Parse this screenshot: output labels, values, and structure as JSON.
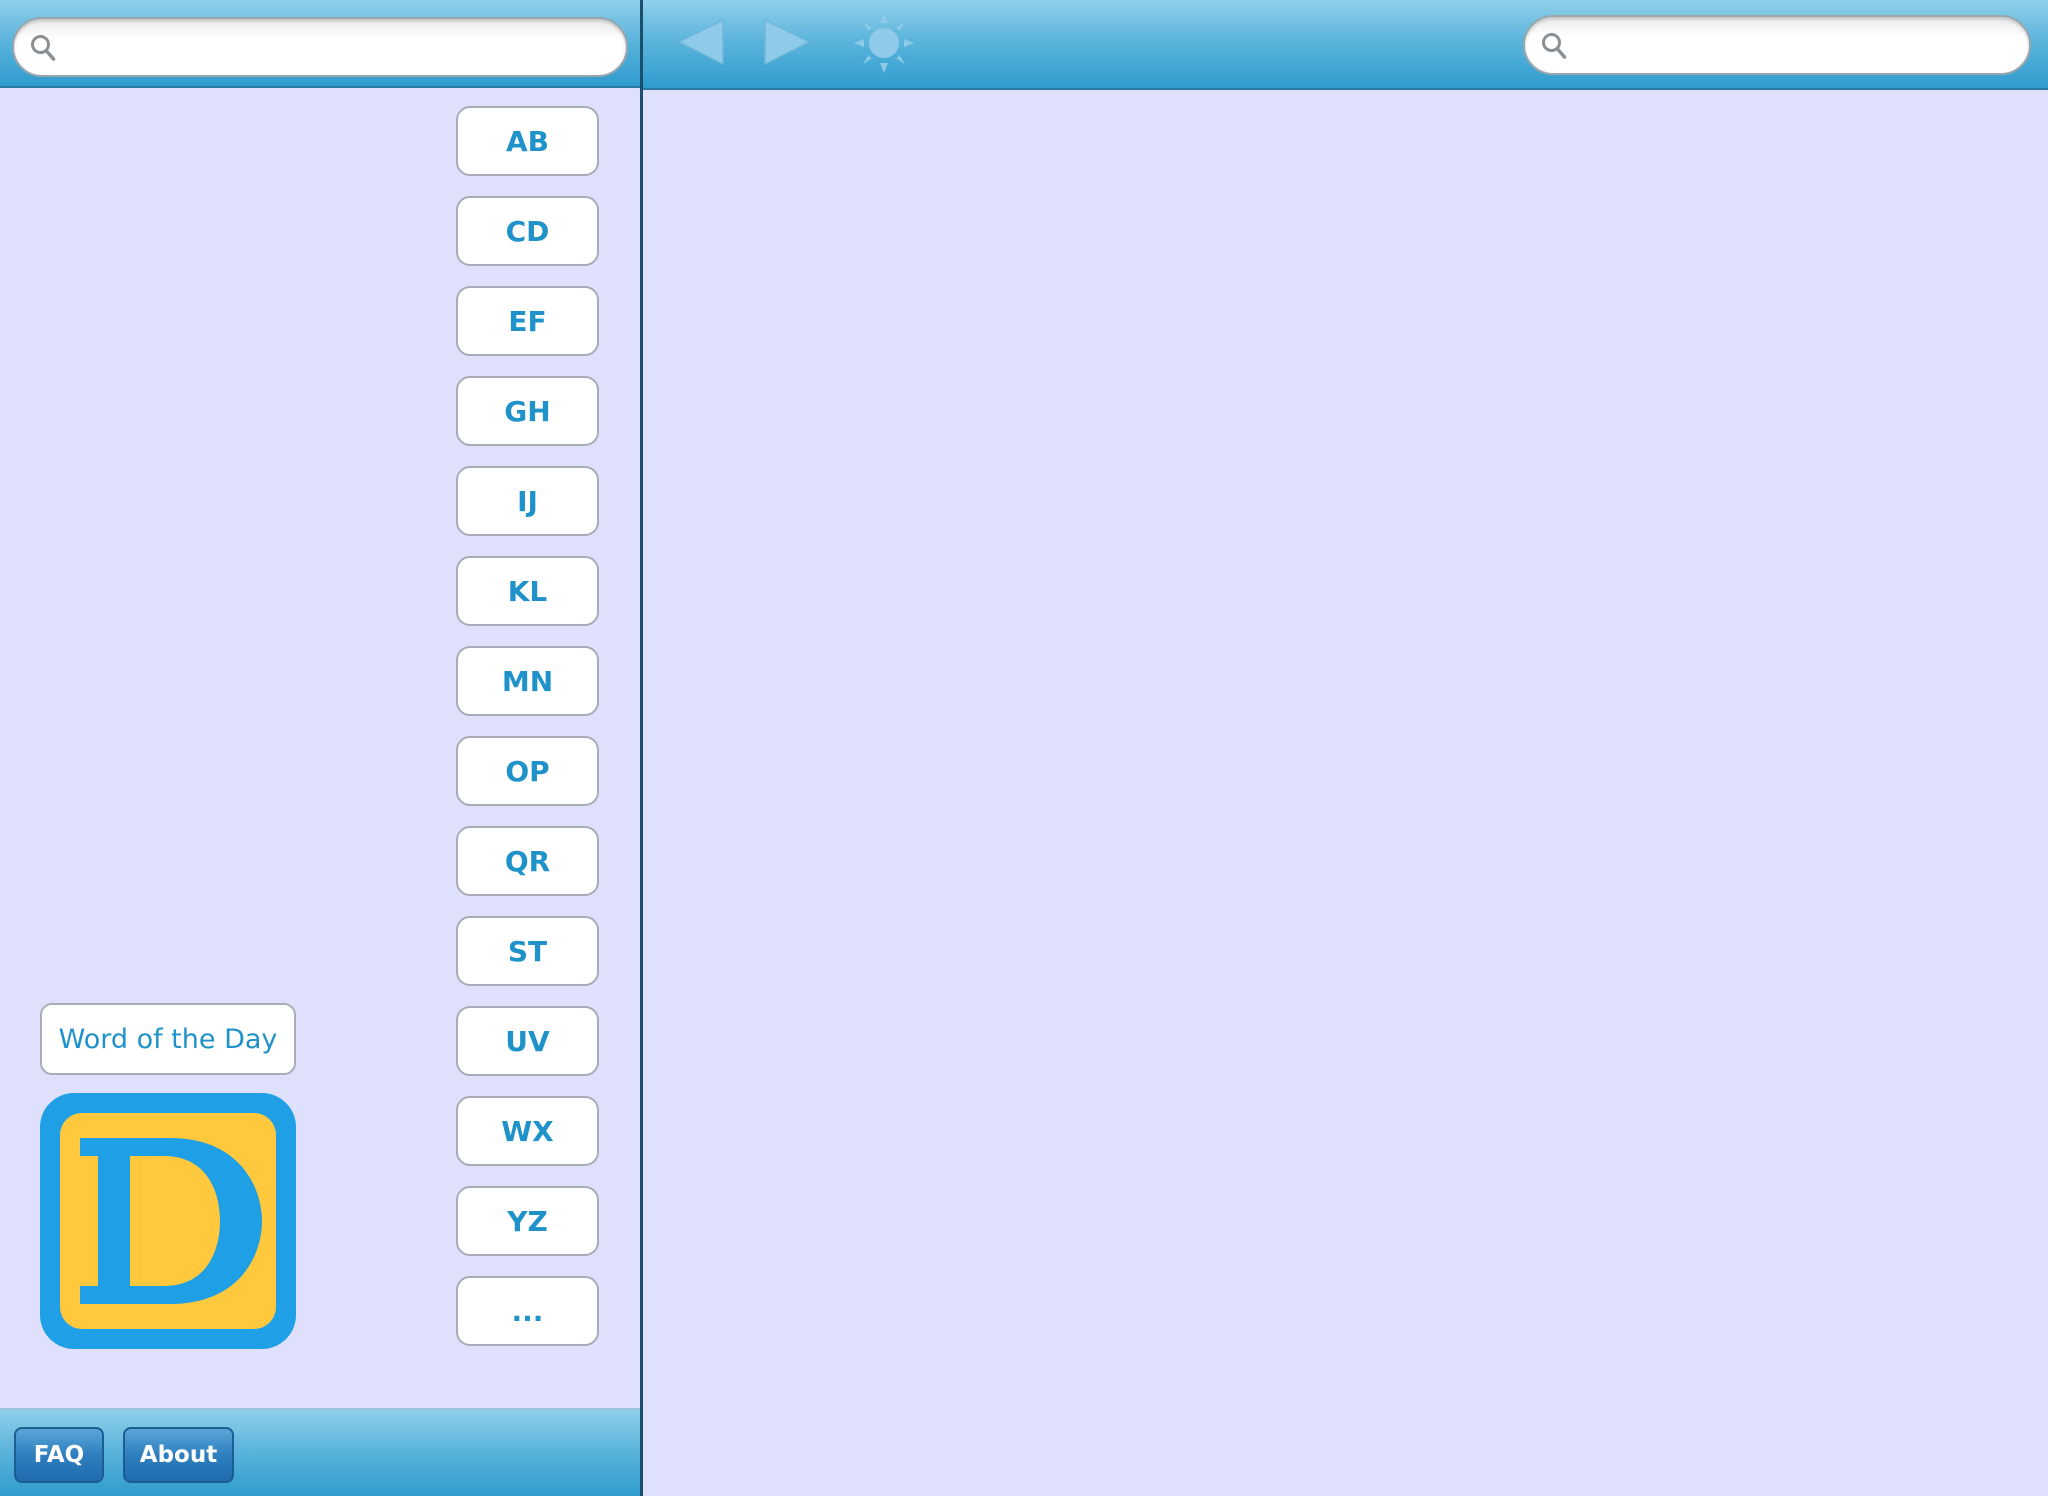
{
  "left_search": {
    "value": "",
    "placeholder": ""
  },
  "letter_index": [
    "AB",
    "CD",
    "EF",
    "GH",
    "IJ",
    "KL",
    "MN",
    "OP",
    "QR",
    "ST",
    "UV",
    "WX",
    "YZ",
    "..."
  ],
  "word_of_the_day": {
    "label": "Word of the Day"
  },
  "logo": {
    "letter": "D",
    "outer_color": "#1e9fe6",
    "inner_color": "#ffc83d"
  },
  "footer": {
    "faq_label": "FAQ",
    "about_label": "About"
  },
  "toolbar": {
    "back_icon": "back-arrow-icon",
    "forward_icon": "forward-arrow-icon",
    "brightness_icon": "sun-icon"
  },
  "right_search": {
    "value": "",
    "placeholder": ""
  },
  "colors": {
    "background": "#dfe0fc",
    "header_gradient_top": "#8fd0ea",
    "header_gradient_bottom": "#2f9ccf",
    "accent_text": "#1f93c9"
  }
}
